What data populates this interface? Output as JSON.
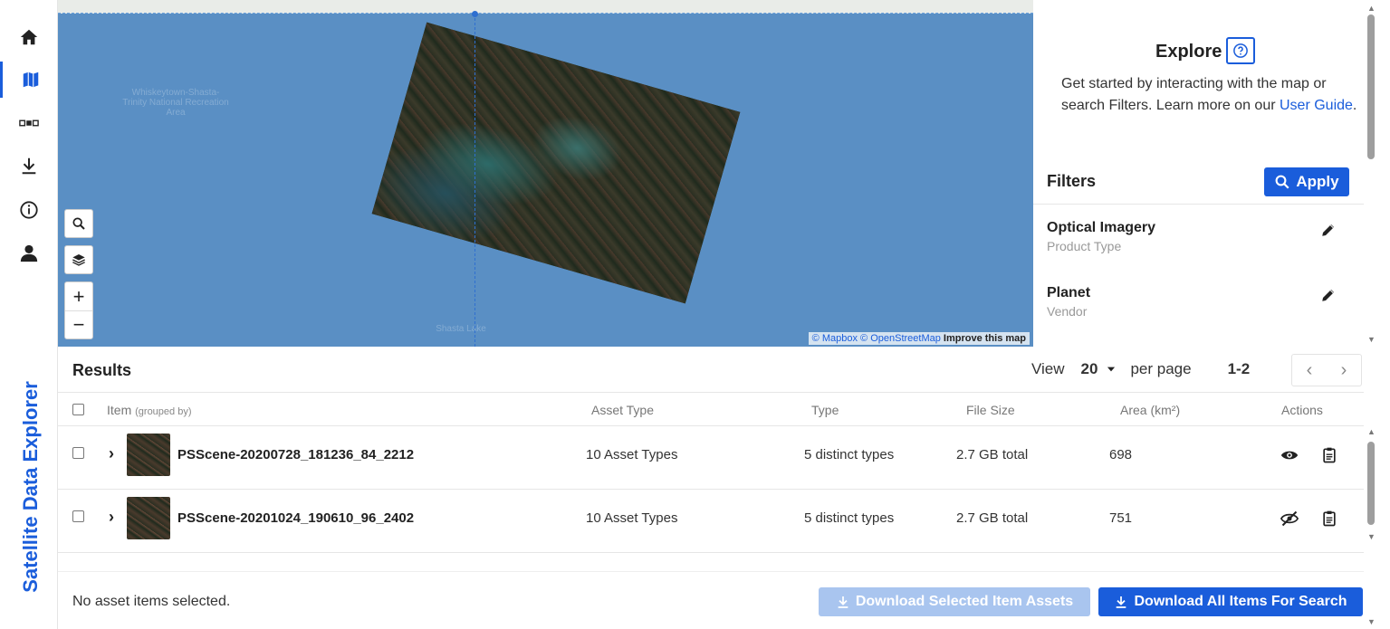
{
  "app": {
    "brand": "Satellite Data Explorer"
  },
  "nav": [
    {
      "name": "home-icon"
    },
    {
      "name": "map-icon"
    },
    {
      "name": "satellite-icon"
    },
    {
      "name": "download-icon"
    },
    {
      "name": "info-icon"
    },
    {
      "name": "user-icon"
    }
  ],
  "map": {
    "labels": {
      "whiskeytown": "Whiskeytown-Shasta-Trinity National Recreation Area",
      "shasta": "Shasta Lake"
    },
    "attribution": {
      "mapbox": "© Mapbox",
      "osm": "© OpenStreetMap",
      "improve": "Improve this map"
    },
    "controls": {
      "zoom_in": "+",
      "zoom_out": "−"
    }
  },
  "explore": {
    "title": "Explore",
    "desc_prefix": "Get started by interacting with the map or search Filters. Learn more on our ",
    "desc_link": "User Guide",
    "desc_suffix": "."
  },
  "filters": {
    "title": "Filters",
    "apply_label": "Apply",
    "items": [
      {
        "name": "Optical Imagery",
        "sub": "Product Type"
      },
      {
        "name": "Planet",
        "sub": "Vendor"
      }
    ]
  },
  "results": {
    "title": "Results",
    "view_label": "View",
    "per_page_value": "20",
    "per_page_label": "per page",
    "range": "1-2",
    "columns": {
      "item": "Item",
      "grouped": "(grouped by)",
      "asset_type": "Asset Type",
      "type": "Type",
      "file_size": "File Size",
      "area": "Area (km²)",
      "actions": "Actions"
    },
    "rows": [
      {
        "id": "PSScene-20200728_181236_84_2212",
        "asset_type": "10 Asset Types",
        "type": "5 distinct types",
        "file_size": "2.7 GB total",
        "area": "698",
        "visible": true
      },
      {
        "id": "PSScene-20201024_190610_96_2402",
        "asset_type": "10 Asset Types",
        "type": "5 distinct types",
        "file_size": "2.7 GB total",
        "area": "751",
        "visible": false
      }
    ]
  },
  "footer": {
    "status": "No asset items selected.",
    "download_selected": "Download Selected Item Assets",
    "download_all": "Download All Items For Search"
  },
  "colors": {
    "accent": "#1a5ddb",
    "map_blue": "#5a8fc4"
  }
}
